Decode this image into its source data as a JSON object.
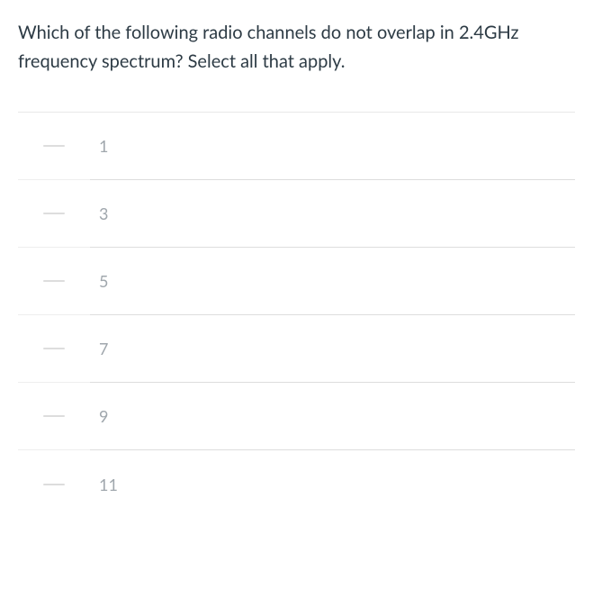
{
  "question": {
    "text": "Which of the following radio channels do not overlap in 2.4GHz frequency spectrum? Select all that apply."
  },
  "answers": [
    {
      "label": "1"
    },
    {
      "label": "3"
    },
    {
      "label": "5"
    },
    {
      "label": "7"
    },
    {
      "label": "9"
    },
    {
      "label": "11"
    }
  ]
}
